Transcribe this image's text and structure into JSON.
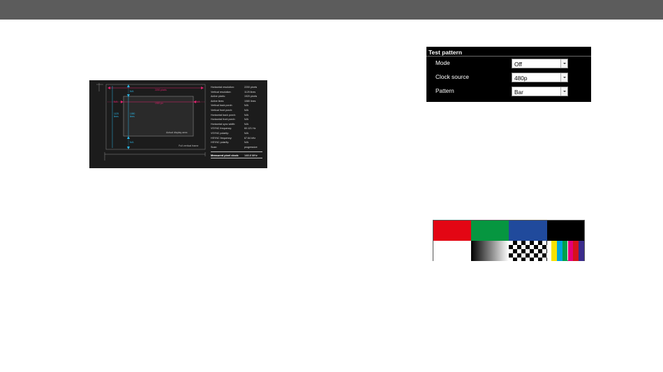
{
  "timing": {
    "params": [
      {
        "label": "Horizontal resolution:",
        "value": "2200 pixels"
      },
      {
        "label": "Vertical resolution:",
        "value": "1125 lines"
      },
      {
        "label": "Active pixels:",
        "value": "1920 pixels"
      },
      {
        "label": "Active lines:",
        "value": "1080 lines"
      },
      {
        "label": "Vertical back porch:",
        "value": "N/A"
      },
      {
        "label": "Vertical front porch:",
        "value": "N/A"
      },
      {
        "label": "Horizontal back porch:",
        "value": "N/A"
      },
      {
        "label": "Horizontal front porch:",
        "value": "N/A"
      },
      {
        "label": "Horizontal sync width:",
        "value": "N/A"
      },
      {
        "label": "VSYNC frequency:",
        "value": "60.121 Hz"
      },
      {
        "label": "VSYNC polarity:",
        "value": "N/A"
      },
      {
        "label": "HSYNC frequency:",
        "value": "67.64 kHz"
      },
      {
        "label": "HSYNC polarity:",
        "value": "N/A"
      },
      {
        "label": "Scan:",
        "value": "progressive"
      }
    ],
    "clock": {
      "label": "Measured pixel clock:",
      "value": "148.8 MHz"
    },
    "labels": {
      "active_area": "Actual display area",
      "full_frame": "Full vertical frame",
      "h_total": "2200",
      "h_total_unit": "pixels",
      "h_active": "1920",
      "h_active_unit": "px",
      "v_total": "1125",
      "v_total_unit": "lines",
      "v_active": "1080",
      "v_active_unit": "lines",
      "na": "N/A"
    }
  },
  "test_pattern": {
    "title": "Test pattern",
    "rows": [
      {
        "label": "Mode",
        "value": "Off"
      },
      {
        "label": "Clock source",
        "value": "480p"
      },
      {
        "label": "Pattern",
        "value": "Bar"
      }
    ]
  },
  "bar_colors": {
    "top": [
      "#e30614",
      "#069640",
      "#204a9c",
      "#000000"
    ],
    "mini": [
      "#f7e100",
      "#00a5d9",
      "#00a14b",
      "#e4007a",
      "#d6121b",
      "#3a2c8c"
    ]
  }
}
